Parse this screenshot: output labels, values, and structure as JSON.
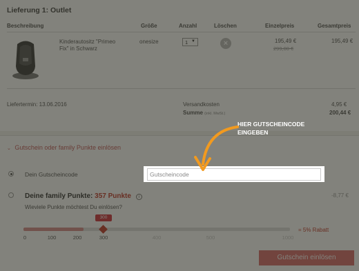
{
  "delivery": {
    "title": "Lieferung 1: Outlet",
    "columns": {
      "description": "Beschreibung",
      "size": "Größe",
      "qty": "Anzahl",
      "delete": "Löschen",
      "unit_price": "Einzelpreis",
      "total_price": "Gesamtpreis"
    },
    "item": {
      "name_line1": "Kinderautositz \"Primeo",
      "name_line2": "Fix\" in Schwarz",
      "size": "onesize",
      "qty": "1",
      "unit_price": "195,49 €",
      "old_price": "299,00 €",
      "total_price": "195,49 €"
    },
    "delivery_date": "Liefertermin: 13.06.2016",
    "shipping_label": "Versandkosten",
    "shipping_value": "4,95 €",
    "sum_label": "Summe",
    "sum_note": "(inkl. MwSt.)",
    "sum_value": "200,44 €"
  },
  "coupon": {
    "toggle_label": "Gutschein oder family Punkte einlösen",
    "code_label": "Dein Gutscheincode",
    "code_placeholder": "Gutscheincode",
    "points_title": "Deine family Punkte:",
    "points_value": "357 Punkte",
    "points_question": "Wieviele Punkte möchtest Du einlösen?",
    "points_discount_value": "-8,77 €",
    "slider": {
      "selected": 300,
      "max": 1000,
      "bubble": "300",
      "ticks": [
        "0",
        "100",
        "200",
        "300",
        "400",
        "500",
        "1000"
      ],
      "discount_label": "= 5% Rabatt"
    },
    "redeem_button": "Gutschein einlösen"
  },
  "hint": {
    "line1": "HIER GUTSCHEINCODE",
    "line2": "EINGEBEN"
  },
  "colors": {
    "accent": "#c0392b",
    "button": "#d96b6b",
    "overlay": "rgba(40,40,30,0.58)"
  }
}
